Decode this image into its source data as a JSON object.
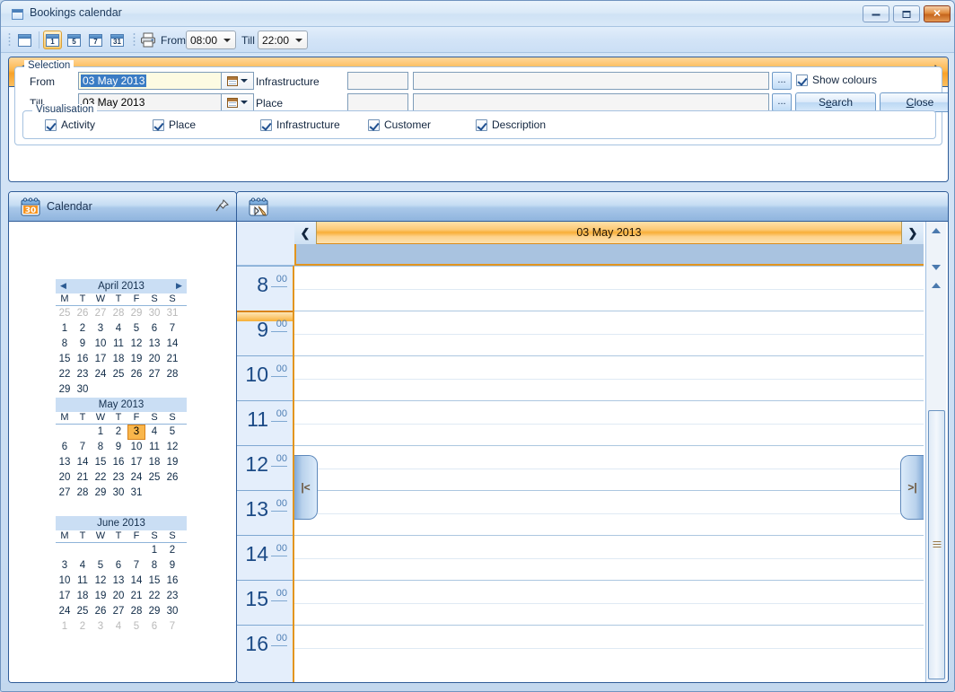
{
  "window": {
    "title": "Bookings calendar",
    "icon": "window-icon",
    "buttons": {
      "minimize": "minimize",
      "maximize": "maximize",
      "close": "close"
    }
  },
  "toolbar": {
    "calendar_icon": "calendar-grid-icon",
    "views": [
      {
        "label": "1",
        "name": "day-view",
        "active": true
      },
      {
        "label": "5",
        "name": "workweek-view",
        "active": false
      },
      {
        "label": "7",
        "name": "week-view",
        "active": false
      },
      {
        "label": "31",
        "name": "month-view",
        "active": false
      }
    ],
    "print_icon": "printer-icon",
    "from_label": "From",
    "from_value": "08:00",
    "till_label": "Till",
    "till_value": "22:00"
  },
  "selection_panel": {
    "header": "Selection",
    "header_icon": "search-binoculars-icon",
    "pin_icon": "pushpin-icon",
    "group_label": "Selection",
    "from_label": "From",
    "from_value": "03 May 2013",
    "till_label": "Till",
    "till_value": "03 May 2013",
    "infrastructure_label": "Infrastructure",
    "infrastructure_code": "",
    "infrastructure_value": "",
    "place_label": "Place",
    "place_code": "",
    "place_value": "",
    "ellipsis_label": "...",
    "show_colours_label": "Show colours",
    "show_colours_checked": true,
    "search_button": "Search",
    "search_accel": "e",
    "close_button": "Close",
    "close_accel": "C",
    "visualisation_label": "Visualisation",
    "visualisation": [
      {
        "label": "Activity",
        "checked": true
      },
      {
        "label": "Place",
        "checked": true
      },
      {
        "label": "Infrastructure",
        "checked": true
      },
      {
        "label": "Customer",
        "checked": true
      },
      {
        "label": "Description",
        "checked": true
      }
    ]
  },
  "calendar_panel": {
    "header": "Calendar",
    "header_icon": "calendar-30-icon",
    "pin_icon": "pushpin-icon",
    "dow": [
      "M",
      "T",
      "W",
      "T",
      "F",
      "S",
      "S"
    ],
    "months": [
      {
        "title": "April 2013",
        "has_nav": true,
        "prev_icon": "chevron-left-icon",
        "next_icon": "chevron-right-icon",
        "days": [
          {
            "d": "25",
            "out": true
          },
          {
            "d": "26",
            "out": true
          },
          {
            "d": "27",
            "out": true
          },
          {
            "d": "28",
            "out": true
          },
          {
            "d": "29",
            "out": true
          },
          {
            "d": "30",
            "out": true
          },
          {
            "d": "31",
            "out": true
          },
          {
            "d": "1"
          },
          {
            "d": "2"
          },
          {
            "d": "3"
          },
          {
            "d": "4"
          },
          {
            "d": "5"
          },
          {
            "d": "6"
          },
          {
            "d": "7"
          },
          {
            "d": "8"
          },
          {
            "d": "9"
          },
          {
            "d": "10"
          },
          {
            "d": "11"
          },
          {
            "d": "12"
          },
          {
            "d": "13"
          },
          {
            "d": "14"
          },
          {
            "d": "15"
          },
          {
            "d": "16"
          },
          {
            "d": "17"
          },
          {
            "d": "18"
          },
          {
            "d": "19"
          },
          {
            "d": "20"
          },
          {
            "d": "21"
          },
          {
            "d": "22"
          },
          {
            "d": "23"
          },
          {
            "d": "24"
          },
          {
            "d": "25"
          },
          {
            "d": "26"
          },
          {
            "d": "27"
          },
          {
            "d": "28"
          },
          {
            "d": "29"
          },
          {
            "d": "30"
          }
        ]
      },
      {
        "title": "May 2013",
        "has_nav": false,
        "days": [
          {
            "d": ""
          },
          {
            "d": ""
          },
          {
            "d": "1"
          },
          {
            "d": "2"
          },
          {
            "d": "3",
            "today": true
          },
          {
            "d": "4"
          },
          {
            "d": "5"
          },
          {
            "d": "6"
          },
          {
            "d": "7"
          },
          {
            "d": "8"
          },
          {
            "d": "9"
          },
          {
            "d": "10"
          },
          {
            "d": "11"
          },
          {
            "d": "12"
          },
          {
            "d": "13"
          },
          {
            "d": "14"
          },
          {
            "d": "15"
          },
          {
            "d": "16"
          },
          {
            "d": "17"
          },
          {
            "d": "18"
          },
          {
            "d": "19"
          },
          {
            "d": "20"
          },
          {
            "d": "21"
          },
          {
            "d": "22"
          },
          {
            "d": "23"
          },
          {
            "d": "24"
          },
          {
            "d": "25"
          },
          {
            "d": "26"
          },
          {
            "d": "27"
          },
          {
            "d": "28"
          },
          {
            "d": "29"
          },
          {
            "d": "30"
          },
          {
            "d": "31"
          }
        ]
      },
      {
        "title": "June 2013",
        "has_nav": false,
        "days": [
          {
            "d": ""
          },
          {
            "d": ""
          },
          {
            "d": ""
          },
          {
            "d": ""
          },
          {
            "d": ""
          },
          {
            "d": "1"
          },
          {
            "d": "2"
          },
          {
            "d": "3"
          },
          {
            "d": "4"
          },
          {
            "d": "5"
          },
          {
            "d": "6"
          },
          {
            "d": "7"
          },
          {
            "d": "8"
          },
          {
            "d": "9"
          },
          {
            "d": "10"
          },
          {
            "d": "11"
          },
          {
            "d": "12"
          },
          {
            "d": "13"
          },
          {
            "d": "14"
          },
          {
            "d": "15"
          },
          {
            "d": "16"
          },
          {
            "d": "17"
          },
          {
            "d": "18"
          },
          {
            "d": "19"
          },
          {
            "d": "20"
          },
          {
            "d": "21"
          },
          {
            "d": "22"
          },
          {
            "d": "23"
          },
          {
            "d": "24"
          },
          {
            "d": "25"
          },
          {
            "d": "26"
          },
          {
            "d": "27"
          },
          {
            "d": "28"
          },
          {
            "d": "29"
          },
          {
            "d": "30"
          },
          {
            "d": "1",
            "out": true
          },
          {
            "d": "2",
            "out": true
          },
          {
            "d": "3",
            "out": true
          },
          {
            "d": "4",
            "out": true
          },
          {
            "d": "5",
            "out": true
          },
          {
            "d": "6",
            "out": true
          },
          {
            "d": "7",
            "out": true
          }
        ]
      }
    ]
  },
  "schedule_panel": {
    "header_icon": "calendar-edit-icon",
    "date_header": "03 May 2013",
    "prev_icon": "chevron-left-icon",
    "next_icon": "chevron-right-icon",
    "hours": [
      {
        "h": "8",
        "m": "00",
        "current": false
      },
      {
        "h": "9",
        "m": "00",
        "current": true
      },
      {
        "h": "10",
        "m": "00",
        "current": false
      },
      {
        "h": "11",
        "m": "00",
        "current": false
      },
      {
        "h": "12",
        "m": "00",
        "current": false
      },
      {
        "h": "13",
        "m": "00",
        "current": false
      },
      {
        "h": "14",
        "m": "00",
        "current": false
      },
      {
        "h": "15",
        "m": "00",
        "current": false
      },
      {
        "h": "16",
        "m": "00",
        "current": false
      }
    ],
    "left_tab_glyph": "|<",
    "right_tab_glyph": ">|",
    "scroll_up_icon": "scroll-up-icon",
    "scroll_down_icon": "scroll-down-icon"
  },
  "colors": {
    "accent_orange": "#f8ae38",
    "panel_border": "#2f5c98",
    "today_highlight": "#f9b64b",
    "window_bg": "#c3d8ee"
  }
}
